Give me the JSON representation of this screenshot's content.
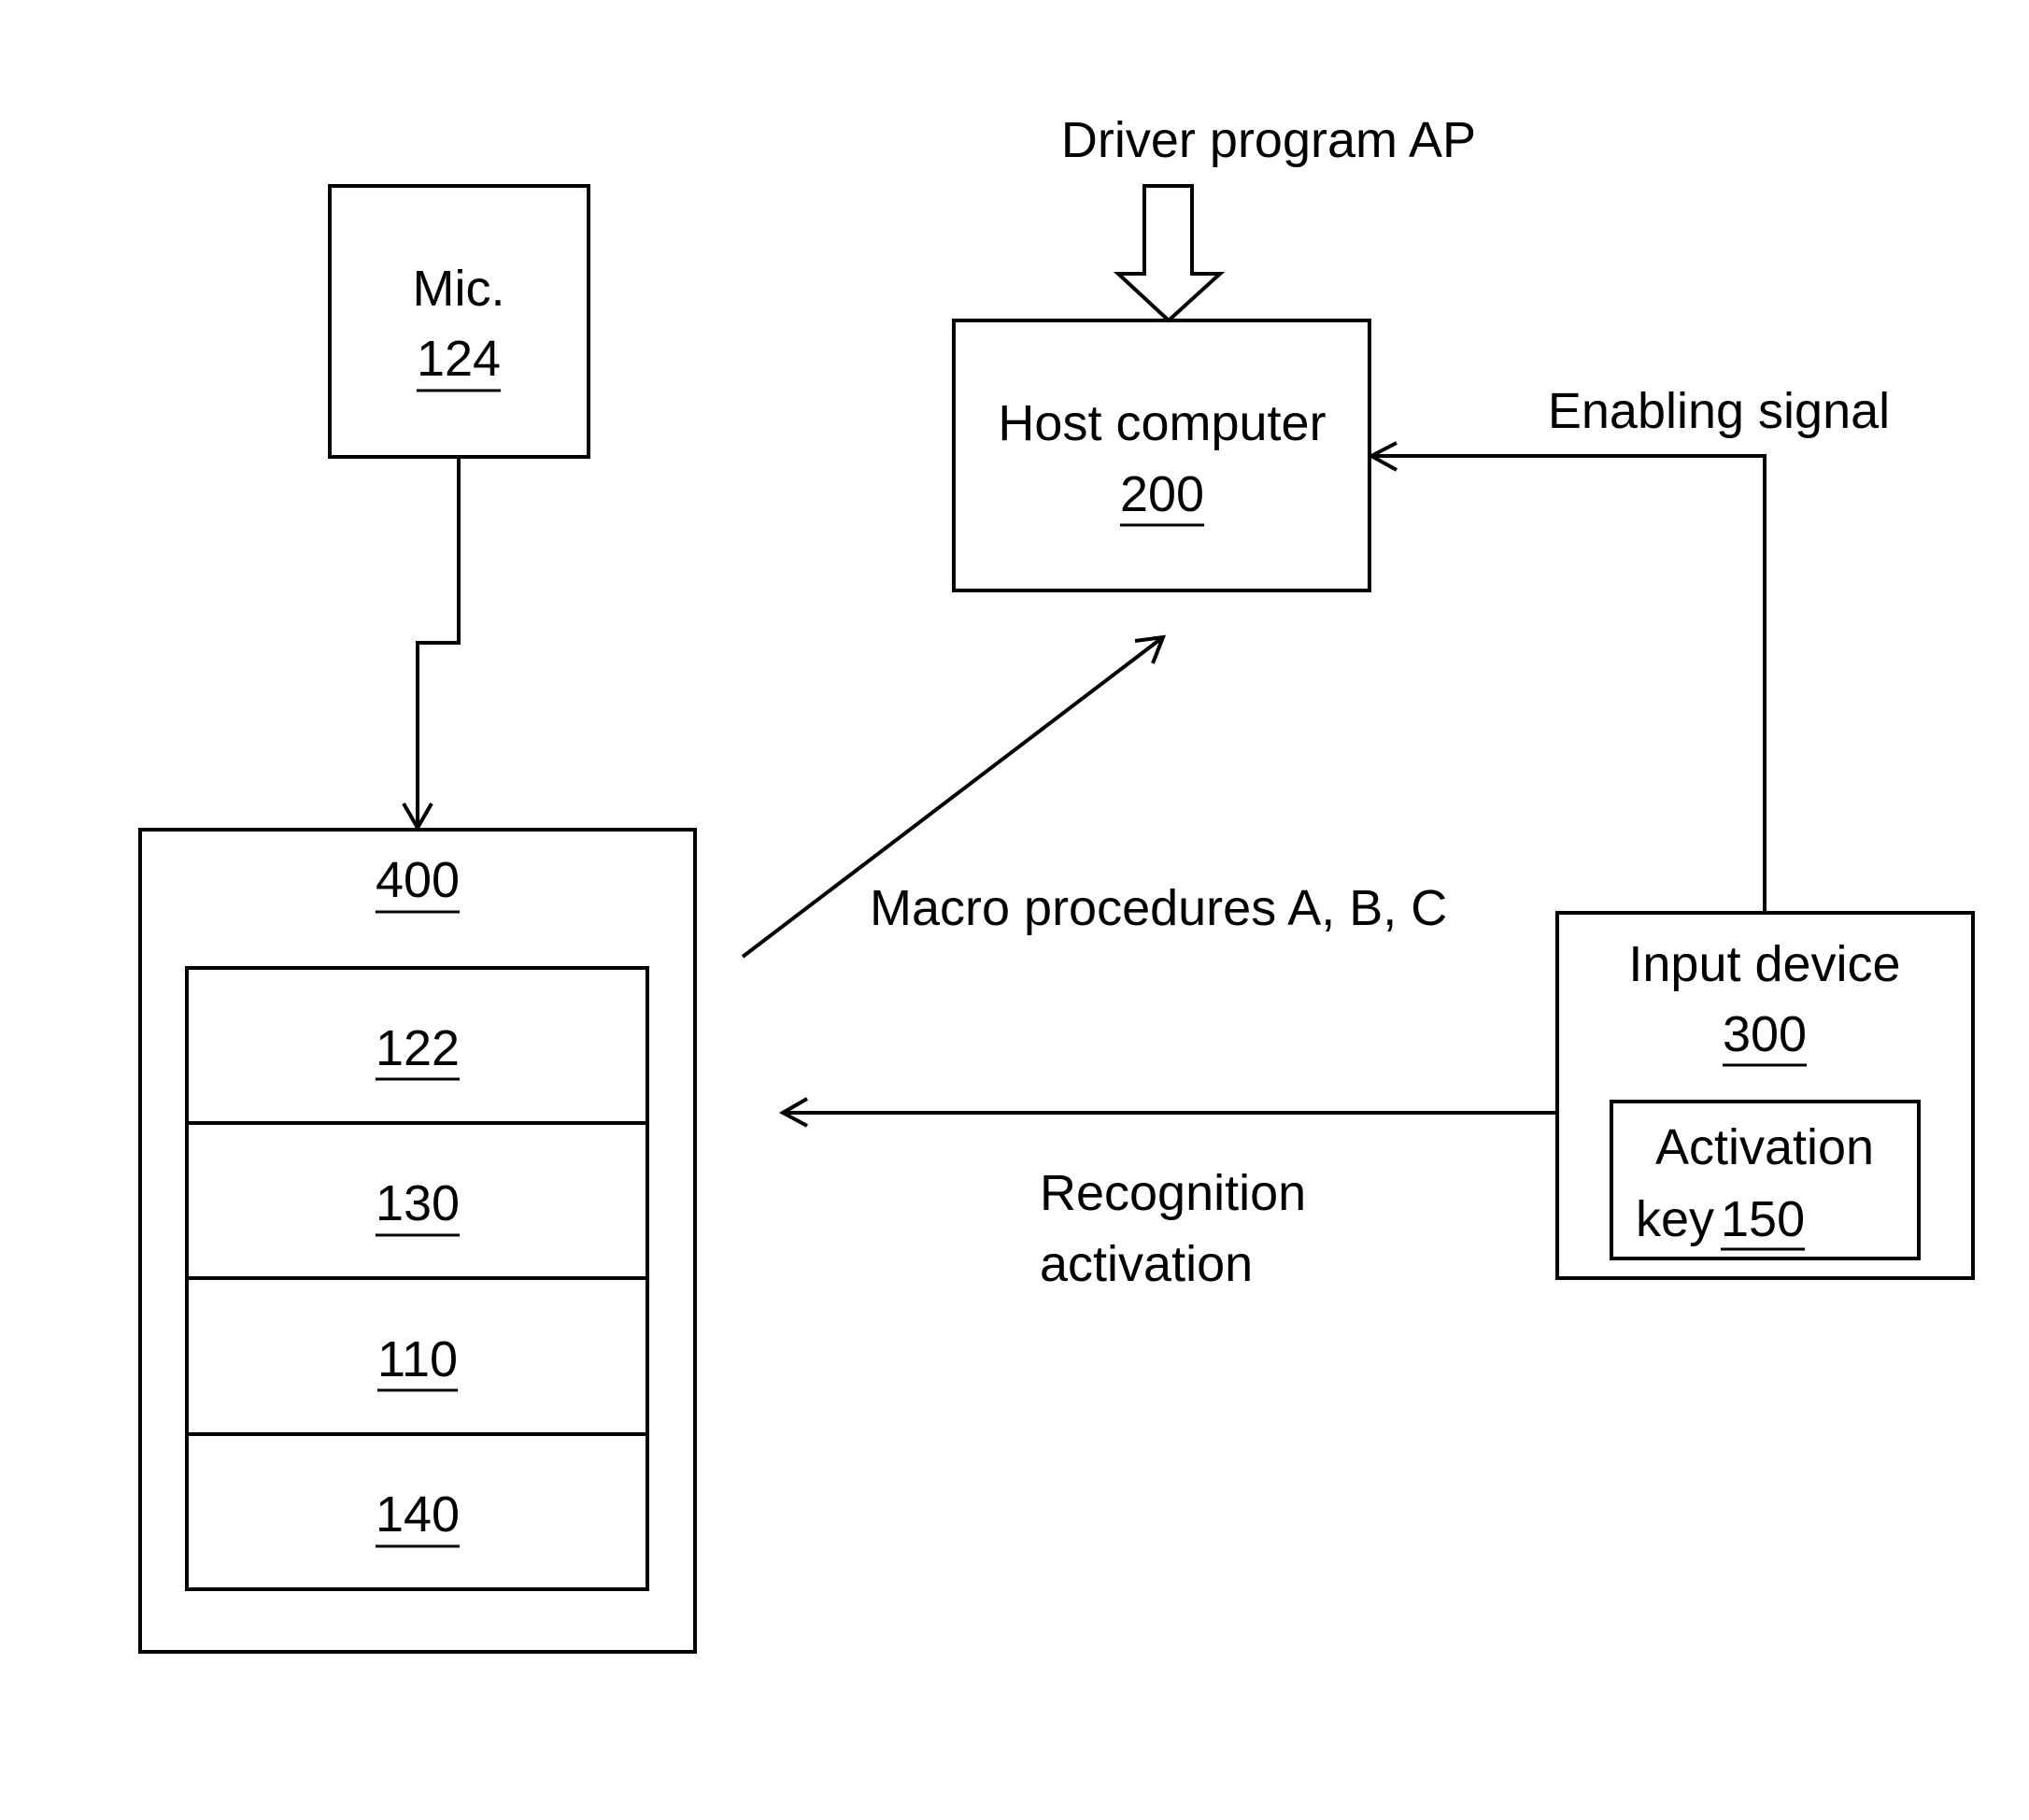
{
  "diagram": {
    "blocks": {
      "mic": {
        "label": "Mic.",
        "ref": "124"
      },
      "host": {
        "label": "Host computer",
        "ref": "200"
      },
      "input_device": {
        "label": "Input device",
        "ref": "300"
      },
      "activation_key": {
        "label_line1": "Activation",
        "label_line2": "key",
        "ref": "150"
      },
      "module": {
        "ref": "400",
        "stack": [
          "122",
          "130",
          "110",
          "140"
        ]
      }
    },
    "connections": {
      "driver_program": {
        "label": "Driver program AP",
        "from": "external",
        "to": "host",
        "style": "block-arrow"
      },
      "enabling_signal": {
        "label": "Enabling signal",
        "from": "input_device",
        "to": "host"
      },
      "macro_procedures": {
        "label": "Macro procedures A, B, C",
        "from": "module",
        "to": "host"
      },
      "recognition_activation": {
        "label_line1": "Recognition",
        "label_line2": "activation",
        "from": "input_device",
        "to": "module"
      },
      "mic_to_module": {
        "label": "",
        "from": "mic",
        "to": "module"
      }
    },
    "colors": {
      "stroke": "#000000",
      "background": "#ffffff"
    }
  }
}
